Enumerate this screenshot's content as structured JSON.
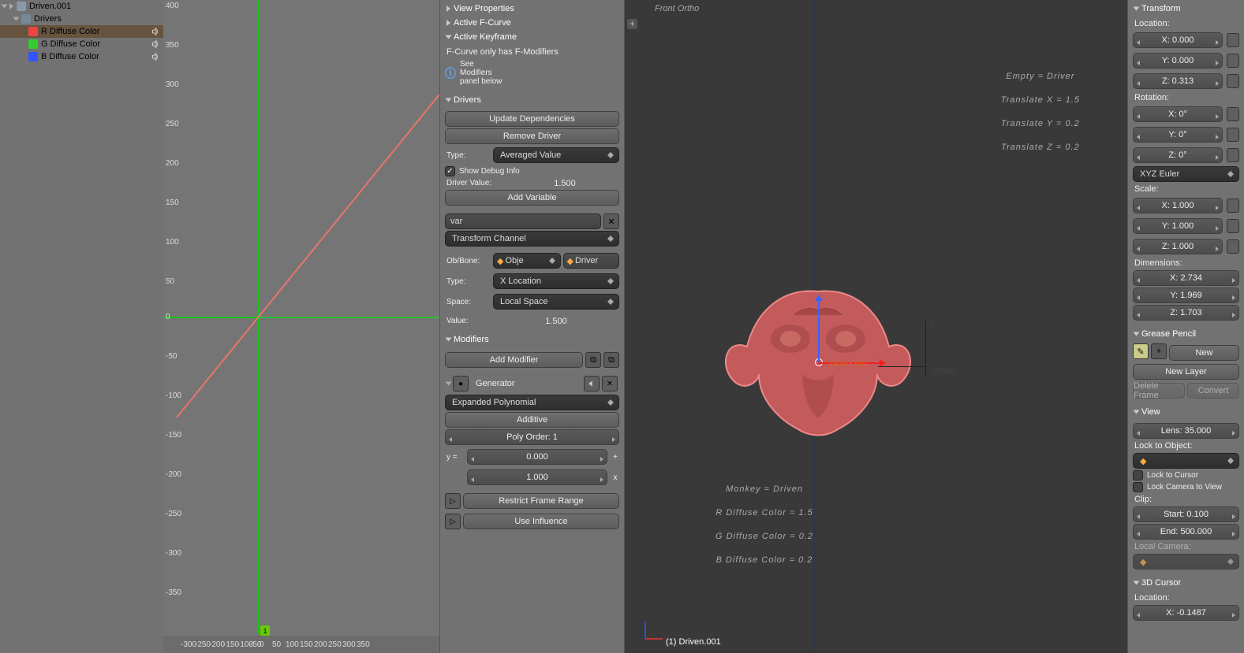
{
  "outliner": {
    "root": "Driven.001",
    "group": "Drivers",
    "channels": [
      {
        "label": "R Diffuse Color",
        "color": "r"
      },
      {
        "label": "G Diffuse Color",
        "color": "g"
      },
      {
        "label": "B Diffuse Color",
        "color": "b"
      }
    ]
  },
  "graph": {
    "y_ticks": [
      "400",
      "350",
      "300",
      "250",
      "200",
      "150",
      "100",
      "50",
      "0",
      "-50",
      "-100",
      "-150",
      "-200",
      "-250",
      "-300",
      "-350"
    ],
    "x_ticks": [
      "-300",
      "-250",
      "-200",
      "-150",
      "-100",
      "-50",
      "0",
      "50",
      "100",
      "150",
      "200",
      "250",
      "300",
      "350"
    ],
    "frame": "1"
  },
  "props": {
    "h_view": "View Properties",
    "h_fcurve": "Active F-Curve",
    "h_keyframe": "Active Keyframe",
    "kf_msg": "F-Curve only has F-Modifiers",
    "kf_info": "See Modifiers panel below",
    "h_drivers": "Drivers",
    "update_deps": "Update Dependencies",
    "remove_driver": "Remove Driver",
    "type_lbl": "Type:",
    "driver_type": "Averaged Value",
    "show_debug": "Show Debug Info",
    "drv_val_lbl": "Driver Value:",
    "drv_val": "1.500",
    "add_var": "Add Variable",
    "var_name": "var",
    "var_kind": "Transform Channel",
    "obbone_lbl": "Ob/Bone:",
    "obj_dd": "Obje",
    "drv_dd": "Driver",
    "var_type_lbl": "Type:",
    "var_type": "X Location",
    "space_lbl": "Space:",
    "var_space": "Local Space",
    "value_lbl": "Value:",
    "var_value": "1.500",
    "h_mods": "Modifiers",
    "add_mod": "Add Modifier",
    "mod_name": "Generator",
    "poly_mode": "Expanded Polynomial",
    "additive": "Additive",
    "poly_order": "Poly Order: 1",
    "y_eq": "y =",
    "coef1": "0.000",
    "plus": "+",
    "coef2": "1.000",
    "x": "x",
    "restrict": "Restrict Frame Range",
    "use_infl": "Use Influence"
  },
  "vp": {
    "title": "Front Ortho",
    "annot1": [
      "Empty = Driver",
      "Translate X = 1.5",
      "Translate Y = 0.2",
      "Translate Z = 0.2"
    ],
    "annot2": [
      "Monkey = Driven",
      "R Diffuse Color = 1.5",
      "G Diffuse Color = 0.2",
      "B Diffuse Color = 0.2"
    ],
    "z": "z",
    "driver_label": "Driver",
    "driven_label": "Driven.001",
    "selected": "(1) Driven.001"
  },
  "right": {
    "h_transform": "Transform",
    "loc_lbl": "Location:",
    "loc": [
      "X: 0.000",
      "Y: 0.000",
      "Z: 0.313"
    ],
    "rot_lbl": "Rotation:",
    "rot": [
      "X: 0°",
      "Y: 0°",
      "Z: 0°"
    ],
    "rot_mode": "XYZ Euler",
    "scale_lbl": "Scale:",
    "scale": [
      "X: 1.000",
      "Y: 1.000",
      "Z: 1.000"
    ],
    "dim_lbl": "Dimensions:",
    "dim": [
      "X: 2.734",
      "Y: 1.969",
      "Z: 1.703"
    ],
    "h_gp": "Grease Pencil",
    "gp_new": "New",
    "gp_layer": "New Layer",
    "gp_del": "Delete Frame",
    "gp_conv": "Convert",
    "h_view": "View",
    "lens": "Lens: 35.000",
    "lock_obj": "Lock to Object:",
    "lock_cur": "Lock to Cursor",
    "lock_cam": "Lock Camera to View",
    "clip_lbl": "Clip:",
    "clip_start": "Start: 0.100",
    "clip_end": "End: 500.000",
    "local_cam": "Local Camera:",
    "h_cursor": "3D Cursor",
    "cur_loc_lbl": "Location:",
    "cur_x": "X: -0.1487"
  }
}
